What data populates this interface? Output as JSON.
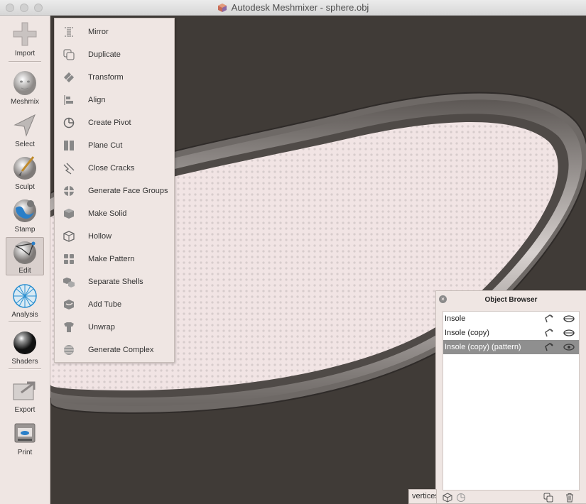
{
  "window": {
    "title": "Autodesk Meshmixer - sphere.obj",
    "app_icon": "meshmixer-logo-icon"
  },
  "toolbar": {
    "items": [
      {
        "label": "Import",
        "icon": "plus-icon"
      },
      {
        "label": "Meshmix",
        "icon": "meshmix-head-icon"
      },
      {
        "label": "Select",
        "icon": "select-arrow-icon"
      },
      {
        "label": "Sculpt",
        "icon": "sculpt-brush-icon"
      },
      {
        "label": "Stamp",
        "icon": "stamp-icon"
      },
      {
        "label": "Edit",
        "icon": "edit-icon",
        "active": true
      },
      {
        "label": "Analysis",
        "icon": "analysis-mesh-icon"
      },
      {
        "label": "Shaders",
        "icon": "shader-sphere-icon"
      },
      {
        "label": "Export",
        "icon": "export-icon"
      },
      {
        "label": "Print",
        "icon": "printer-icon"
      }
    ]
  },
  "edit_menu": {
    "items": [
      {
        "label": "Mirror",
        "icon": "mirror-icon"
      },
      {
        "label": "Duplicate",
        "icon": "duplicate-icon"
      },
      {
        "label": "Transform",
        "icon": "transform-icon"
      },
      {
        "label": "Align",
        "icon": "align-icon"
      },
      {
        "label": "Create Pivot",
        "icon": "pivot-icon"
      },
      {
        "label": "Plane Cut",
        "icon": "plane-cut-icon"
      },
      {
        "label": "Close Cracks",
        "icon": "close-cracks-icon"
      },
      {
        "label": "Generate Face Groups",
        "icon": "face-groups-icon"
      },
      {
        "label": "Make Solid",
        "icon": "make-solid-icon"
      },
      {
        "label": "Hollow",
        "icon": "hollow-icon"
      },
      {
        "label": "Make Pattern",
        "icon": "make-pattern-icon"
      },
      {
        "label": "Separate Shells",
        "icon": "separate-shells-icon"
      },
      {
        "label": "Add Tube",
        "icon": "add-tube-icon"
      },
      {
        "label": "Unwrap",
        "icon": "unwrap-icon"
      },
      {
        "label": "Generate Complex",
        "icon": "generate-complex-icon"
      }
    ]
  },
  "object_browser": {
    "title": "Object Browser",
    "objects": [
      {
        "name": "Insole",
        "selected": false
      },
      {
        "name": "Insole (copy)",
        "selected": false
      },
      {
        "name": "Insole (copy) (pattern)",
        "selected": true
      }
    ]
  },
  "status": {
    "vertices_label": "vertices"
  },
  "colors": {
    "panel_bg": "#efe6e3",
    "viewport_bg": "#403b37",
    "selected_row": "#8f8f8f",
    "mesh_fill": "#f3e7e7"
  }
}
